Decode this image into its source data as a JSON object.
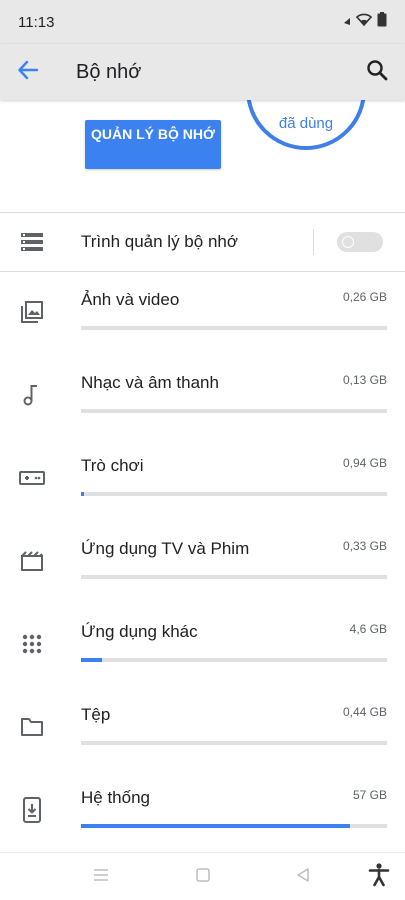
{
  "status_bar": {
    "time": "11:13",
    "icons": [
      "wifi-icon",
      "battery-icon"
    ]
  },
  "app_bar": {
    "title": "Bộ nhớ",
    "back_icon": "arrow-back-icon",
    "search_icon": "search-icon"
  },
  "summary": {
    "usage_label": "đã dùng",
    "manage_button": "QUẢN LÝ BỘ NHỚ"
  },
  "storage_manager": {
    "label": "Trình quản lý bộ nhớ",
    "toggle_on": false,
    "icon": "storage-icon"
  },
  "categories": [
    {
      "label": "Ảnh và video",
      "size": "0,26 GB",
      "fill": 0.0,
      "icon": "photos-icon"
    },
    {
      "label": "Nhạc và âm thanh",
      "size": "0,13 GB",
      "fill": 0.0,
      "icon": "music-note-icon"
    },
    {
      "label": "Trò chơi",
      "size": "0,94 GB",
      "fill": 0.01,
      "icon": "gamepad-icon"
    },
    {
      "label": "Ứng dụng TV và Phim",
      "size": "0,33 GB",
      "fill": 0.0,
      "icon": "movie-icon"
    },
    {
      "label": "Ứng dụng khác",
      "size": "4,6 GB",
      "fill": 0.07,
      "icon": "apps-grid-icon"
    },
    {
      "label": "Tệp",
      "size": "0,44 GB",
      "fill": 0.0,
      "icon": "folder-icon"
    },
    {
      "label": "Hệ thống",
      "size": "57 GB",
      "fill": 0.88,
      "icon": "system-update-icon"
    }
  ],
  "colors": {
    "accent": "#3b82f0",
    "app_bar_bg": "#e8e8e8",
    "track": "#e0e0e0"
  },
  "nav_bar": {
    "icons": [
      "menu-icon",
      "home-icon",
      "back-triangle-icon",
      "accessibility-icon"
    ]
  }
}
